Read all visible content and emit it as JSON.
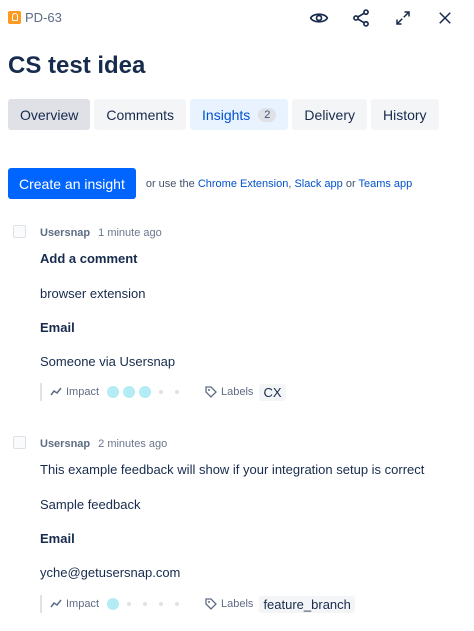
{
  "header": {
    "issue_key": "PD-63",
    "icons": [
      "eye-icon",
      "share-icon",
      "expand-icon",
      "close-icon"
    ]
  },
  "title": "CS test idea",
  "tabs": [
    {
      "label": "Overview",
      "state": "active"
    },
    {
      "label": "Comments",
      "state": "normal"
    },
    {
      "label": "Insights",
      "state": "highlight",
      "count": "2"
    },
    {
      "label": "Delivery",
      "state": "normal"
    },
    {
      "label": "History",
      "state": "normal"
    }
  ],
  "create": {
    "button_label": "Create an insight",
    "note_prefix": "or use the",
    "link_chrome": "Chrome Extension",
    "comma": ",",
    "link_slack": "Slack app",
    "or": "or",
    "link_teams": "Teams app"
  },
  "insights": [
    {
      "author": "Usersnap",
      "time": "1 minute ago",
      "lines": [
        {
          "text": "Add a comment",
          "bold": true
        },
        {
          "text": "browser extension",
          "bold": false
        },
        {
          "text": "Email",
          "bold": true
        },
        {
          "text": "Someone via Usersnap",
          "bold": false
        }
      ],
      "impact_label": "Impact",
      "impact_level": 3,
      "impact_max": 5,
      "labels_label": "Labels",
      "label": "CX"
    },
    {
      "author": "Usersnap",
      "time": "2 minutes ago",
      "lines": [
        {
          "text": "This example feedback will show if your integration setup is correct",
          "bold": false
        },
        {
          "text": "Sample feedback",
          "bold": false
        },
        {
          "text": "Email",
          "bold": true
        },
        {
          "text": "yche@getusersnap.com",
          "bold": false
        }
      ],
      "impact_label": "Impact",
      "impact_level": 1,
      "impact_max": 5,
      "labels_label": "Labels",
      "label": "feature_branch"
    }
  ],
  "colors": {
    "accent": "#0065ff",
    "link": "#0052cc",
    "impact_dot": "#b3ecf5",
    "issue_icon": "#ff991f"
  }
}
